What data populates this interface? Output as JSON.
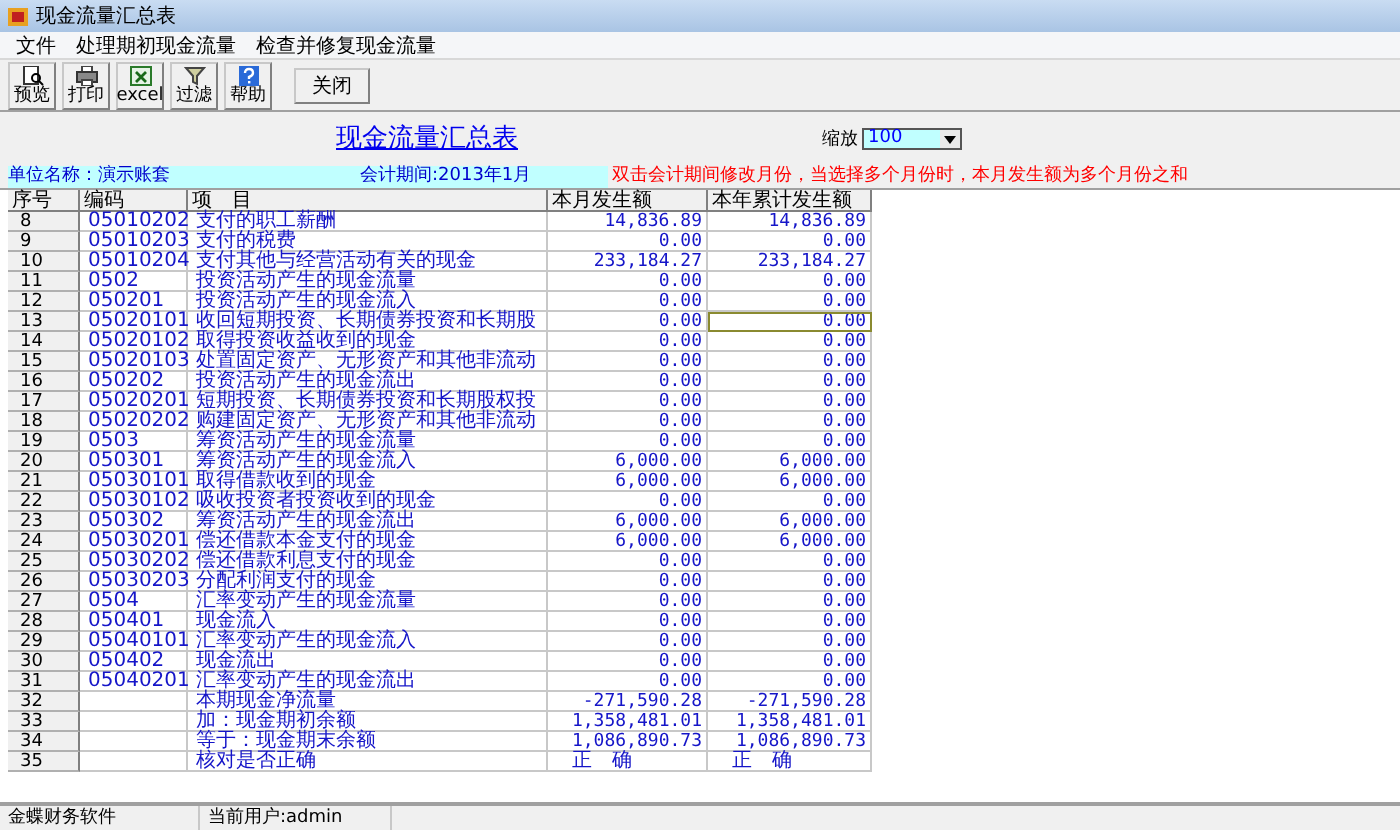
{
  "window": {
    "title": "现金流量汇总表"
  },
  "menu": [
    "文件",
    "处理期初现金流量",
    "检查并修复现金流量"
  ],
  "toolbar": [
    {
      "label": "预览",
      "kind": "preview"
    },
    {
      "label": "打印",
      "kind": "print"
    },
    {
      "label": "excel",
      "kind": "excel"
    },
    {
      "label": "过滤",
      "kind": "filter"
    },
    {
      "label": "帮助",
      "kind": "help"
    },
    {
      "label": "关闭",
      "kind": "text"
    }
  ],
  "report_title": "现金流量汇总表",
  "zoom": {
    "label": "缩放",
    "value": "100"
  },
  "company": "单位名称：演示账套",
  "period": "会计期间:2013年1月",
  "hint": "双击会计期间修改月份，当选择多个月份时，本月发生额为多个月份之和",
  "table": {
    "columns": [
      "序号",
      "编码",
      "项　目",
      "本月发生额",
      "本年累计发生额"
    ],
    "rows": [
      {
        "no": "8",
        "code": "05010202",
        "item": "支付的职工薪酬",
        "month": "14,836.89",
        "year": "14,836.89",
        "focused": false
      },
      {
        "no": "9",
        "code": "05010203",
        "item": "支付的税费",
        "month": "0.00",
        "year": "0.00",
        "focused": false
      },
      {
        "no": "10",
        "code": "05010204",
        "item": "支付其他与经营活动有关的现金",
        "month": "233,184.27",
        "year": "233,184.27",
        "focused": false
      },
      {
        "no": "11",
        "code": "0502",
        "item": "投资活动产生的现金流量",
        "month": "0.00",
        "year": "0.00",
        "focused": false
      },
      {
        "no": "12",
        "code": "050201",
        "item": "投资活动产生的现金流入",
        "month": "0.00",
        "year": "0.00",
        "focused": false
      },
      {
        "no": "13",
        "code": "05020101",
        "item": "收回短期投资、长期债券投资和长期股",
        "month": "0.00",
        "year": "0.00",
        "focused": true
      },
      {
        "no": "14",
        "code": "05020102",
        "item": "取得投资收益收到的现金",
        "month": "0.00",
        "year": "0.00",
        "focused": false
      },
      {
        "no": "15",
        "code": "05020103",
        "item": "处置固定资产、无形资产和其他非流动",
        "month": "0.00",
        "year": "0.00",
        "focused": false
      },
      {
        "no": "16",
        "code": "050202",
        "item": "投资活动产生的现金流出",
        "month": "0.00",
        "year": "0.00",
        "focused": false
      },
      {
        "no": "17",
        "code": "05020201",
        "item": "短期投资、长期债券投资和长期股权投",
        "month": "0.00",
        "year": "0.00",
        "focused": false
      },
      {
        "no": "18",
        "code": "05020202",
        "item": "购建固定资产、无形资产和其他非流动",
        "month": "0.00",
        "year": "0.00",
        "focused": false
      },
      {
        "no": "19",
        "code": "0503",
        "item": "筹资活动产生的现金流量",
        "month": "0.00",
        "year": "0.00",
        "focused": false
      },
      {
        "no": "20",
        "code": "050301",
        "item": "筹资活动产生的现金流入",
        "month": "6,000.00",
        "year": "6,000.00",
        "focused": false
      },
      {
        "no": "21",
        "code": "05030101",
        "item": "取得借款收到的现金",
        "month": "6,000.00",
        "year": "6,000.00",
        "focused": false
      },
      {
        "no": "22",
        "code": "05030102",
        "item": "吸收投资者投资收到的现金",
        "month": "0.00",
        "year": "0.00",
        "focused": false
      },
      {
        "no": "23",
        "code": "050302",
        "item": "筹资活动产生的现金流出",
        "month": "6,000.00",
        "year": "6,000.00",
        "focused": false
      },
      {
        "no": "24",
        "code": "05030201",
        "item": "偿还借款本金支付的现金",
        "month": "6,000.00",
        "year": "6,000.00",
        "focused": false
      },
      {
        "no": "25",
        "code": "05030202",
        "item": "偿还借款利息支付的现金",
        "month": "0.00",
        "year": "0.00",
        "focused": false
      },
      {
        "no": "26",
        "code": "05030203",
        "item": "分配利润支付的现金",
        "month": "0.00",
        "year": "0.00",
        "focused": false
      },
      {
        "no": "27",
        "code": "0504",
        "item": "汇率变动产生的现金流量",
        "month": "0.00",
        "year": "0.00",
        "focused": false
      },
      {
        "no": "28",
        "code": "050401",
        "item": "现金流入",
        "month": "0.00",
        "year": "0.00",
        "focused": false
      },
      {
        "no": "29",
        "code": "05040101",
        "item": "汇率变动产生的现金流入",
        "month": "0.00",
        "year": "0.00",
        "focused": false
      },
      {
        "no": "30",
        "code": "050402",
        "item": "现金流出",
        "month": "0.00",
        "year": "0.00",
        "focused": false
      },
      {
        "no": "31",
        "code": "05040201",
        "item": "汇率变动产生的现金流出",
        "month": "0.00",
        "year": "0.00",
        "focused": false
      },
      {
        "no": "32",
        "item": "本期现金净流量",
        "month": "-271,590.28",
        "year": "-271,590.28",
        "focused": false
      },
      {
        "no": "33",
        "item": "加：现金期初余额",
        "month": "1,358,481.01",
        "year": "1,358,481.01",
        "focused": false
      },
      {
        "no": "34",
        "item": "等于：现金期末余额",
        "month": "1,086,890.73",
        "year": "1,086,890.73",
        "focused": false
      },
      {
        "no": "35",
        "item": "核对是否正确",
        "month": "正　确",
        "year": "正　确",
        "focused": false,
        "kind": "check"
      }
    ]
  },
  "status_bar": [
    "金蝶财务软件",
    "当前用户:admin"
  ]
}
